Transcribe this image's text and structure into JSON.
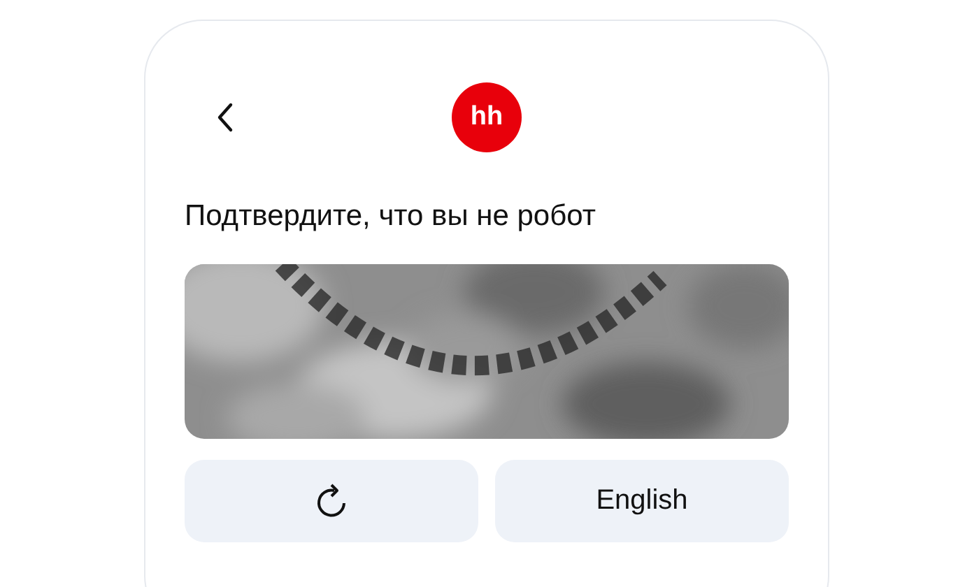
{
  "logo": {
    "text": "hh"
  },
  "title": "Подтвердите, что вы не робот",
  "buttons": [
    {
      "kind": "refresh"
    },
    {
      "kind": "text",
      "label": "English"
    }
  ]
}
